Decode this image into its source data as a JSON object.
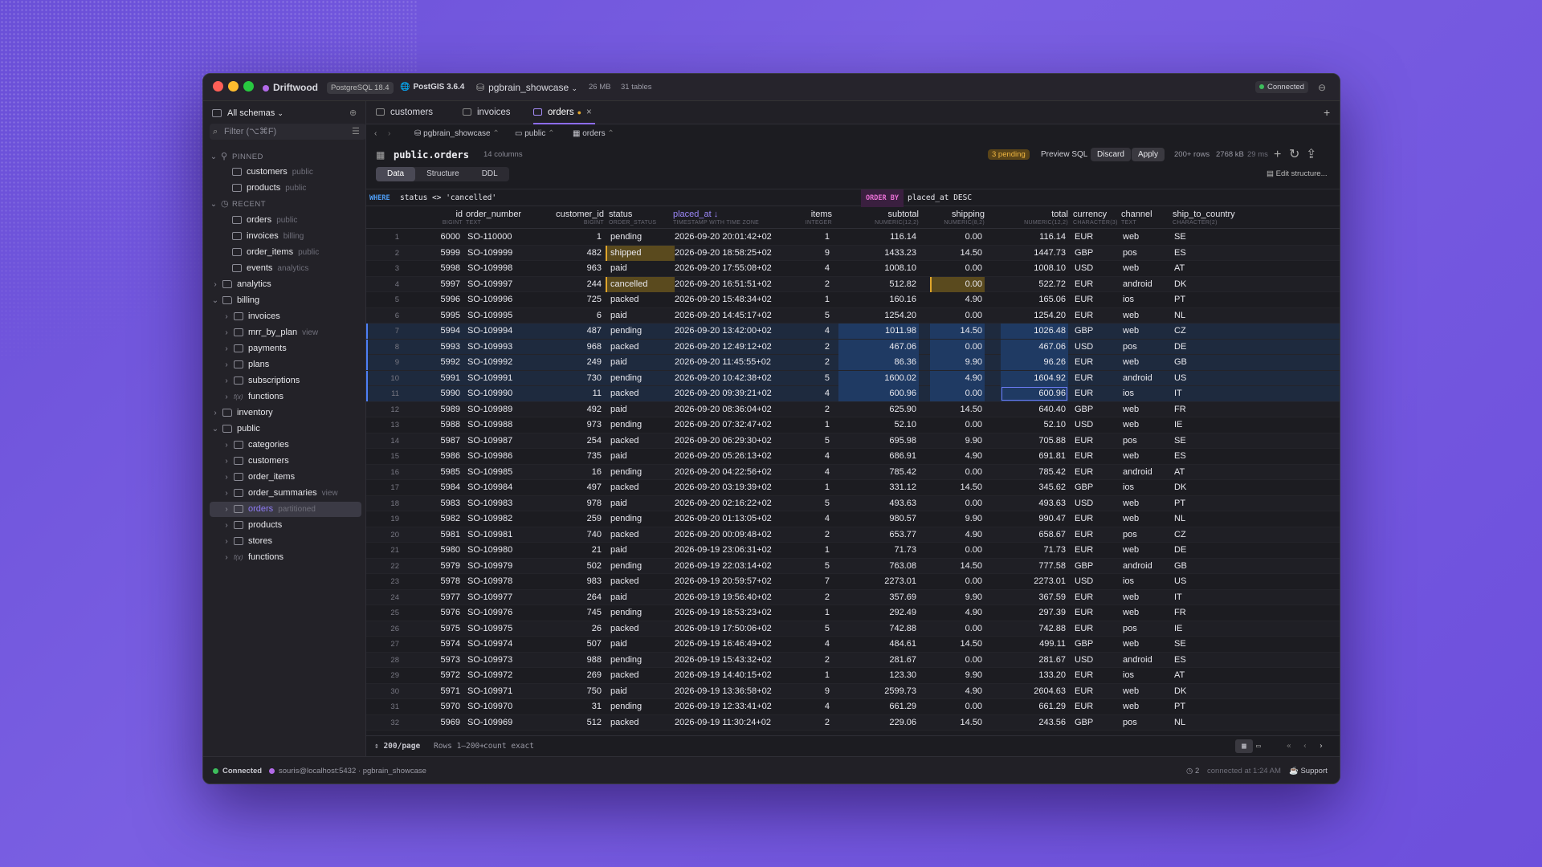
{
  "app": {
    "name": "Driftwood",
    "pg_version": "PostgreSQL 18.4",
    "postgis": "PostGIS 3.6.4",
    "database": "pgbrain_showcase",
    "db_size": "26 MB",
    "tables": "31 tables",
    "connection": "Connected"
  },
  "sidebar": {
    "schema_select": "All schemas",
    "filter_placeholder": "Filter  (⌥⌘F)",
    "sections": {
      "pinned": "PINNED",
      "recent": "RECENT"
    },
    "items": [
      {
        "label": "customers",
        "sub": "public"
      },
      {
        "label": "products",
        "sub": "public"
      },
      {
        "label": "orders",
        "sub": "public"
      },
      {
        "label": "invoices",
        "sub": "billing"
      },
      {
        "label": "order_items",
        "sub": "public"
      },
      {
        "label": "events",
        "sub": "analytics"
      },
      {
        "label": "analytics",
        "sub": ""
      },
      {
        "label": "billing",
        "sub": ""
      },
      {
        "label": "invoices",
        "sub": ""
      },
      {
        "label": "mrr_by_plan",
        "sub": "view"
      },
      {
        "label": "payments",
        "sub": ""
      },
      {
        "label": "plans",
        "sub": ""
      },
      {
        "label": "subscriptions",
        "sub": ""
      },
      {
        "label": "functions",
        "sub": ""
      },
      {
        "label": "inventory",
        "sub": ""
      },
      {
        "label": "public",
        "sub": ""
      },
      {
        "label": "categories",
        "sub": ""
      },
      {
        "label": "customers",
        "sub": ""
      },
      {
        "label": "order_items",
        "sub": ""
      },
      {
        "label": "order_summaries",
        "sub": "view"
      },
      {
        "label": "orders",
        "sub": "partitioned"
      },
      {
        "label": "products",
        "sub": ""
      },
      {
        "label": "stores",
        "sub": ""
      },
      {
        "label": "functions",
        "sub": ""
      }
    ]
  },
  "tabs": [
    {
      "label": "customers"
    },
    {
      "label": "invoices"
    },
    {
      "label": "orders"
    }
  ],
  "breadcrumb": [
    "pgbrain_showcase",
    "public",
    "orders"
  ],
  "table": {
    "name": "public.orders",
    "columns_count": "14 columns",
    "pending": "3 pending",
    "preview_sql": "Preview SQL",
    "discard": "Discard",
    "apply": "Apply",
    "rows": "200+ rows",
    "size": "2768 kB",
    "time": "29 ms",
    "edit_structure": "Edit structure..."
  },
  "view_tabs": [
    "Data",
    "Structure",
    "DDL"
  ],
  "filter": {
    "where_kw": "WHERE",
    "where": "status <> 'cancelled'",
    "order_kw": "ORDER BY",
    "order": "placed_at DESC"
  },
  "columns": [
    {
      "name": "id",
      "type": "BIGINT"
    },
    {
      "name": "order_number",
      "type": "TEXT"
    },
    {
      "name": "customer_id",
      "type": "BIGINT"
    },
    {
      "name": "status",
      "type": "ORDER_STATUS"
    },
    {
      "name": "placed_at ↓",
      "type": "TIMESTAMP WITH TIME ZONE"
    },
    {
      "name": "items",
      "type": "INTEGER"
    },
    {
      "name": "subtotal",
      "type": "NUMERIC(12,2)"
    },
    {
      "name": "shipping",
      "type": "NUMERIC(8,2)"
    },
    {
      "name": "total",
      "type": "NUMERIC(12,2)"
    },
    {
      "name": "currency",
      "type": "CHARACTER(3)"
    },
    {
      "name": "channel",
      "type": "TEXT"
    },
    {
      "name": "ship_to_country",
      "type": "CHARACTER(2)"
    }
  ],
  "rows": [
    [
      "1",
      "6000",
      "SO-110000",
      "1",
      "pending",
      "2026-09-20 20:01:42+02",
      "1",
      "116.14",
      "0.00",
      "116.14",
      "EUR",
      "web",
      "SE"
    ],
    [
      "2",
      "5999",
      "SO-109999",
      "482",
      "shipped",
      "2026-09-20 18:58:25+02",
      "9",
      "1433.23",
      "14.50",
      "1447.73",
      "GBP",
      "pos",
      "ES"
    ],
    [
      "3",
      "5998",
      "SO-109998",
      "963",
      "paid",
      "2026-09-20 17:55:08+02",
      "4",
      "1008.10",
      "0.00",
      "1008.10",
      "USD",
      "web",
      "AT"
    ],
    [
      "4",
      "5997",
      "SO-109997",
      "244",
      "cancelled",
      "2026-09-20 16:51:51+02",
      "2",
      "512.82",
      "0.00",
      "522.72",
      "EUR",
      "android",
      "DK"
    ],
    [
      "5",
      "5996",
      "SO-109996",
      "725",
      "packed",
      "2026-09-20 15:48:34+02",
      "1",
      "160.16",
      "4.90",
      "165.06",
      "EUR",
      "ios",
      "PT"
    ],
    [
      "6",
      "5995",
      "SO-109995",
      "6",
      "paid",
      "2026-09-20 14:45:17+02",
      "5",
      "1254.20",
      "0.00",
      "1254.20",
      "EUR",
      "web",
      "NL"
    ],
    [
      "7",
      "5994",
      "SO-109994",
      "487",
      "pending",
      "2026-09-20 13:42:00+02",
      "4",
      "1011.98",
      "14.50",
      "1026.48",
      "GBP",
      "web",
      "CZ"
    ],
    [
      "8",
      "5993",
      "SO-109993",
      "968",
      "packed",
      "2026-09-20 12:49:12+02",
      "2",
      "467.06",
      "0.00",
      "467.06",
      "USD",
      "pos",
      "DE"
    ],
    [
      "9",
      "5992",
      "SO-109992",
      "249",
      "paid",
      "2026-09-20 11:45:55+02",
      "2",
      "86.36",
      "9.90",
      "96.26",
      "EUR",
      "web",
      "GB"
    ],
    [
      "10",
      "5991",
      "SO-109991",
      "730",
      "pending",
      "2026-09-20 10:42:38+02",
      "5",
      "1600.02",
      "4.90",
      "1604.92",
      "EUR",
      "android",
      "US"
    ],
    [
      "11",
      "5990",
      "SO-109990",
      "11",
      "packed",
      "2026-09-20 09:39:21+02",
      "4",
      "600.96",
      "0.00",
      "600.96",
      "EUR",
      "ios",
      "IT"
    ],
    [
      "12",
      "5989",
      "SO-109989",
      "492",
      "paid",
      "2026-09-20 08:36:04+02",
      "2",
      "625.90",
      "14.50",
      "640.40",
      "GBP",
      "web",
      "FR"
    ],
    [
      "13",
      "5988",
      "SO-109988",
      "973",
      "pending",
      "2026-09-20 07:32:47+02",
      "1",
      "52.10",
      "0.00",
      "52.10",
      "USD",
      "web",
      "IE"
    ],
    [
      "14",
      "5987",
      "SO-109987",
      "254",
      "packed",
      "2026-09-20 06:29:30+02",
      "5",
      "695.98",
      "9.90",
      "705.88",
      "EUR",
      "pos",
      "SE"
    ],
    [
      "15",
      "5986",
      "SO-109986",
      "735",
      "paid",
      "2026-09-20 05:26:13+02",
      "4",
      "686.91",
      "4.90",
      "691.81",
      "EUR",
      "web",
      "ES"
    ],
    [
      "16",
      "5985",
      "SO-109985",
      "16",
      "pending",
      "2026-09-20 04:22:56+02",
      "4",
      "785.42",
      "0.00",
      "785.42",
      "EUR",
      "android",
      "AT"
    ],
    [
      "17",
      "5984",
      "SO-109984",
      "497",
      "packed",
      "2026-09-20 03:19:39+02",
      "1",
      "331.12",
      "14.50",
      "345.62",
      "GBP",
      "ios",
      "DK"
    ],
    [
      "18",
      "5983",
      "SO-109983",
      "978",
      "paid",
      "2026-09-20 02:16:22+02",
      "5",
      "493.63",
      "0.00",
      "493.63",
      "USD",
      "web",
      "PT"
    ],
    [
      "19",
      "5982",
      "SO-109982",
      "259",
      "pending",
      "2026-09-20 01:13:05+02",
      "4",
      "980.57",
      "9.90",
      "990.47",
      "EUR",
      "web",
      "NL"
    ],
    [
      "20",
      "5981",
      "SO-109981",
      "740",
      "packed",
      "2026-09-20 00:09:48+02",
      "2",
      "653.77",
      "4.90",
      "658.67",
      "EUR",
      "pos",
      "CZ"
    ],
    [
      "21",
      "5980",
      "SO-109980",
      "21",
      "paid",
      "2026-09-19 23:06:31+02",
      "1",
      "71.73",
      "0.00",
      "71.73",
      "EUR",
      "web",
      "DE"
    ],
    [
      "22",
      "5979",
      "SO-109979",
      "502",
      "pending",
      "2026-09-19 22:03:14+02",
      "5",
      "763.08",
      "14.50",
      "777.58",
      "GBP",
      "android",
      "GB"
    ],
    [
      "23",
      "5978",
      "SO-109978",
      "983",
      "packed",
      "2026-09-19 20:59:57+02",
      "7",
      "2273.01",
      "0.00",
      "2273.01",
      "USD",
      "ios",
      "US"
    ],
    [
      "24",
      "5977",
      "SO-109977",
      "264",
      "paid",
      "2026-09-19 19:56:40+02",
      "2",
      "357.69",
      "9.90",
      "367.59",
      "EUR",
      "web",
      "IT"
    ],
    [
      "25",
      "5976",
      "SO-109976",
      "745",
      "pending",
      "2026-09-19 18:53:23+02",
      "1",
      "292.49",
      "4.90",
      "297.39",
      "EUR",
      "web",
      "FR"
    ],
    [
      "26",
      "5975",
      "SO-109975",
      "26",
      "packed",
      "2026-09-19 17:50:06+02",
      "5",
      "742.88",
      "0.00",
      "742.88",
      "EUR",
      "pos",
      "IE"
    ],
    [
      "27",
      "5974",
      "SO-109974",
      "507",
      "paid",
      "2026-09-19 16:46:49+02",
      "4",
      "484.61",
      "14.50",
      "499.11",
      "GBP",
      "web",
      "SE"
    ],
    [
      "28",
      "5973",
      "SO-109973",
      "988",
      "pending",
      "2026-09-19 15:43:32+02",
      "2",
      "281.67",
      "0.00",
      "281.67",
      "USD",
      "android",
      "ES"
    ],
    [
      "29",
      "5972",
      "SO-109972",
      "269",
      "packed",
      "2026-09-19 14:40:15+02",
      "1",
      "123.30",
      "9.90",
      "133.20",
      "EUR",
      "ios",
      "AT"
    ],
    [
      "30",
      "5971",
      "SO-109971",
      "750",
      "paid",
      "2026-09-19 13:36:58+02",
      "9",
      "2599.73",
      "4.90",
      "2604.63",
      "EUR",
      "web",
      "DK"
    ],
    [
      "31",
      "5970",
      "SO-109970",
      "31",
      "pending",
      "2026-09-19 12:33:41+02",
      "4",
      "661.29",
      "0.00",
      "661.29",
      "EUR",
      "web",
      "PT"
    ],
    [
      "32",
      "5969",
      "SO-109969",
      "512",
      "packed",
      "2026-09-19 11:30:24+02",
      "2",
      "229.06",
      "14.50",
      "243.56",
      "GBP",
      "pos",
      "NL"
    ]
  ],
  "footer": {
    "per_page": "200/page",
    "rows_range": "Rows 1–200+",
    "count": "count exact"
  },
  "status": {
    "connected": "Connected",
    "conn_string": "souris@localhost:5432 · pgbrain_showcase",
    "count": "2",
    "connected_at": "connected at 1:24 AM",
    "support": "Support"
  },
  "colors": {
    "accent": "#7c6cf0",
    "pending": "#e0a52b",
    "selection": "#1f3a63",
    "connected": "#3dbd5c"
  }
}
